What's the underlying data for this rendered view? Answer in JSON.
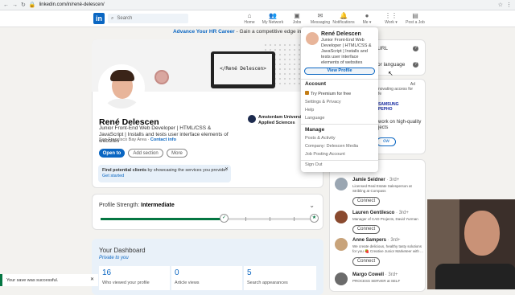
{
  "browser": {
    "url": "linkedin.com/in/rené-delescen/"
  },
  "nav": {
    "search_placeholder": "Search",
    "items": [
      {
        "label": "Home",
        "icon": "home-icon"
      },
      {
        "label": "My Network",
        "icon": "network-icon"
      },
      {
        "label": "Jobs",
        "icon": "jobs-icon"
      },
      {
        "label": "Messaging",
        "icon": "messaging-icon"
      },
      {
        "label": "Notifications",
        "icon": "bell-icon"
      },
      {
        "label": "Me ▾",
        "icon": "avatar"
      },
      {
        "label": "Work ▾",
        "icon": "grid-icon"
      },
      {
        "label": "Post a Job",
        "icon": "post-job-icon"
      }
    ]
  },
  "banner": {
    "link": "Advance Your HR Career",
    "text": " - Gain a competitive edge in HR: online MS in"
  },
  "cover": {
    "screen_text": "</René Delescen>"
  },
  "profile": {
    "name": "René Delescen",
    "headline": "Junior Front-End Web Developer | HTML/CSS & JavaScript | Installs and tests user interface elements of websites",
    "location": "San Francisco Bay Area",
    "contact": "Contact info",
    "education": "Amsterdam University of Applied Sciences",
    "buttons": {
      "open_to": "Open to",
      "add_section": "Add section",
      "more": "More"
    }
  },
  "clients_card": {
    "bold": "Find potential clients",
    "text": " by showcasing the services you provide.",
    "link": "Get started"
  },
  "strength": {
    "label": "Profile Strength: ",
    "level": "Intermediate",
    "progress": 0.58
  },
  "dashboard": {
    "title": "Your Dashboard",
    "subtitle": "Private to you",
    "stats": [
      {
        "value": "16",
        "label": "Who viewed your profile"
      },
      {
        "value": "0",
        "label": "Article views"
      },
      {
        "value": "5",
        "label": "Search appearances"
      }
    ]
  },
  "toast": {
    "text": "Your save was successful."
  },
  "right": {
    "url_label": "URL",
    "language_label": "or language",
    "ad_label": "Ad",
    "ad_text1": "novating access for",
    "ad_text1b": "fe",
    "ad_brand": "SAMSUNG",
    "ad_brand2": "PEPHO",
    "ad_text2": "work on high-quality",
    "ad_text2b": "jects",
    "ad_button": "ow"
  },
  "people": [
    {
      "name": "Jamie Seidner",
      "degree": "· 3rd+",
      "desc": "Licensed Real Estate Salesperson at Stribling at Compass",
      "action": "Connect"
    },
    {
      "name": "Lauren Gentilesco",
      "degree": "· 3rd+",
      "desc": "Manager of CAD Projects, David Yurman",
      "action": "Connect"
    },
    {
      "name": "Anne Sampers",
      "degree": "· 3rd+",
      "desc": "We create delicious, healthy tasty solutions for you 🍓 Creative Junior Marketeer with ...",
      "action": "Connect"
    },
    {
      "name": "Margo Cowell",
      "degree": "· 3rd+",
      "desc": "PROCESS SERVER at SELF",
      "action": ""
    }
  ],
  "dropdown": {
    "name": "René Delescen",
    "desc": "Junior Front-End Web Developer | HTML/CSS & JavaScript | Installs and tests user interface elements of websites",
    "view_profile": "View Profile",
    "account_header": "Account",
    "account_items": [
      "Try Premium for free",
      "Settings & Privacy",
      "Help",
      "Language"
    ],
    "manage_header": "Manage",
    "manage_items": [
      "Posts & Activity",
      "Company: Delescen Media",
      "Job Posting Account"
    ],
    "signout": "Sign Out"
  },
  "colors": {
    "brand": "#0a66c2",
    "success": "#057642",
    "page_bg": "#f3f2ef"
  }
}
